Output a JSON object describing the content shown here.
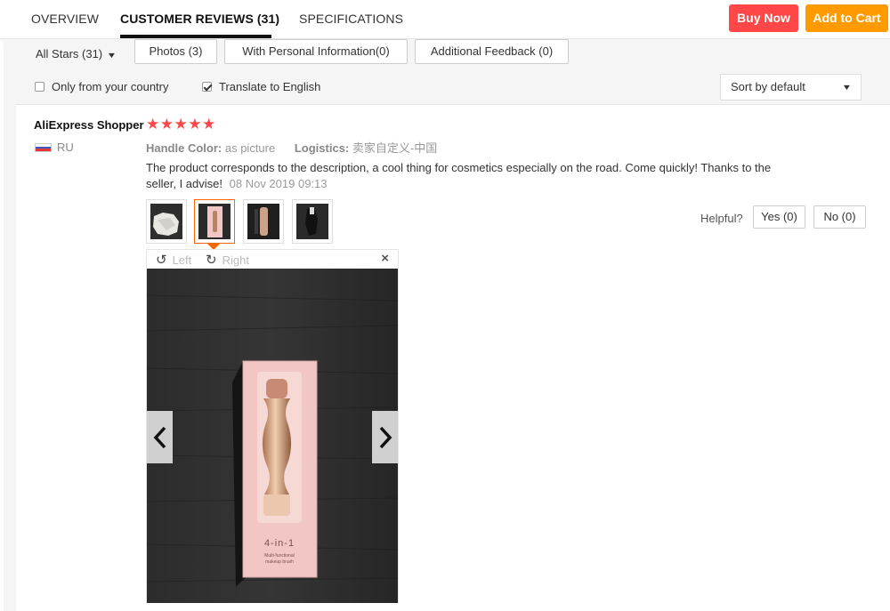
{
  "tabs": {
    "overview": "OVERVIEW",
    "reviews": "CUSTOMER REVIEWS (31)",
    "specs": "SPECIFICATIONS"
  },
  "actions": {
    "buy_now": "Buy Now",
    "add_to_cart": "Add to Cart"
  },
  "filters": {
    "stars_dropdown": "All Stars (31)",
    "photos": "Photos (3)",
    "personal_info": "With Personal Information(0)",
    "additional_feedback": "Additional Feedback (0)",
    "only_country": {
      "label": "Only from your country",
      "checked": false
    },
    "translate": {
      "label": "Translate to English",
      "checked": true
    },
    "sort": "Sort by default"
  },
  "review": {
    "author": "AliExpress Shopper",
    "stars": "★★★★★",
    "rating": 5,
    "country": "RU",
    "handle_color_label": "Handle Color:",
    "handle_color_value": "as picture",
    "logistics_label": "Logistics:",
    "logistics_value": "卖家自定义-中国",
    "text": "The product corresponds to the description, a cool thing for cosmetics especially on the road. Come quickly! Thanks to the seller, I advise!",
    "date": "08 Nov 2019 09:13",
    "thumbnail_count": 4,
    "selected_thumbnail": 2
  },
  "helpful": {
    "label": "Helpful?",
    "yes": "Yes (0)",
    "no": "No (0)"
  },
  "viewer": {
    "rotate_left": "Left",
    "rotate_right": "Right",
    "close": "×"
  },
  "product_box": {
    "line1": "4-in-1",
    "line2": "Multi-functional",
    "line3": "makeup brush"
  },
  "colors": {
    "buy_now": "#ff4747",
    "add_to_cart": "#ff9a00",
    "stars": "#ff4747",
    "selected_thumb": "#ff6600"
  }
}
